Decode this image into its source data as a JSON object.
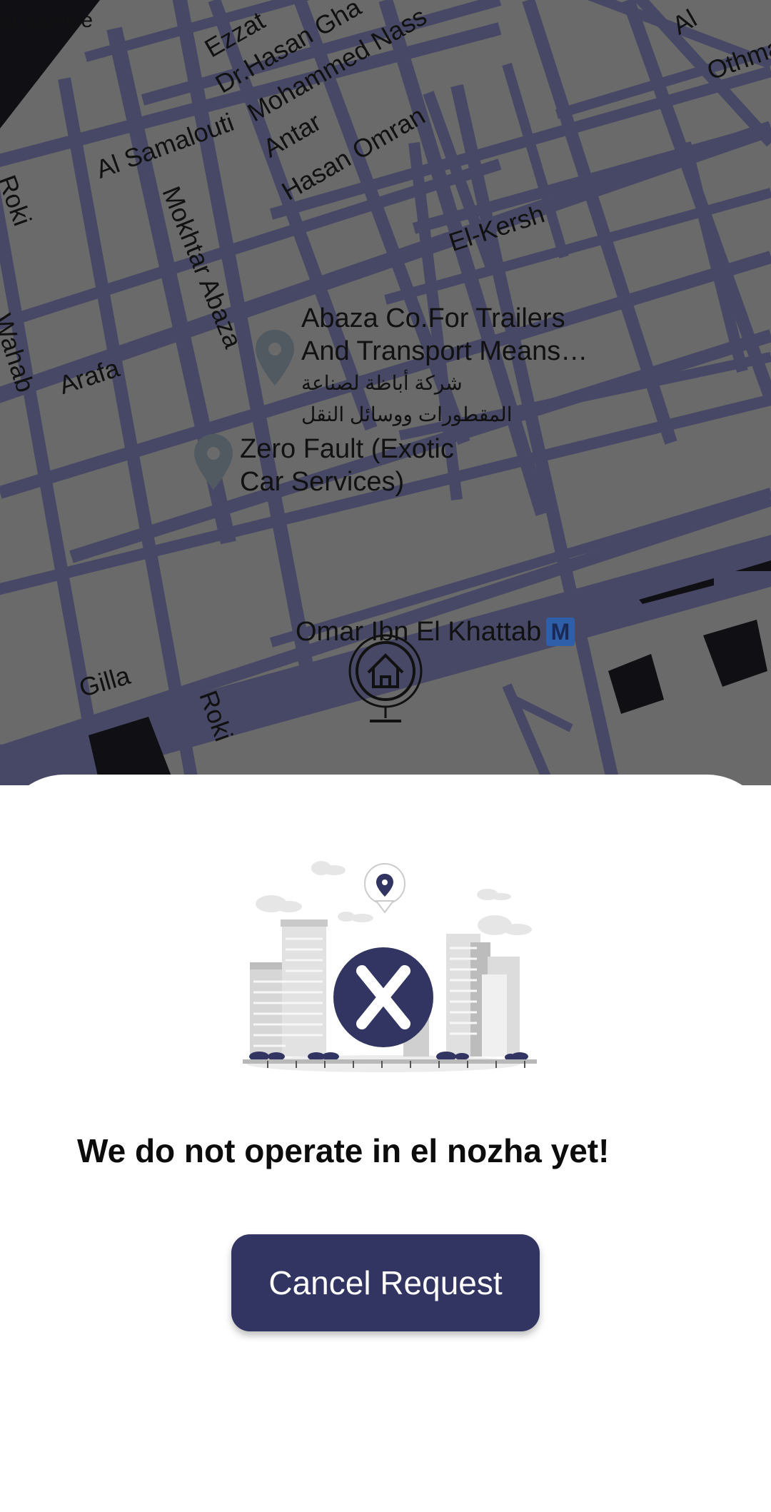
{
  "map": {
    "streets": [
      "Ezzat",
      "Dr.Hasan Gha",
      "Mohammed Nass",
      "Antar",
      "Hasan Omran",
      "Al Samalouti",
      "Mokhtar Abaza",
      "El-Kersh",
      "Arafa",
      "Roki",
      "Wahab",
      "Gilla",
      "Roki",
      "Al",
      "Othman"
    ],
    "corner_label": "ar service",
    "pois": [
      {
        "name_line1": "Abaza Co.For Trailers",
        "name_line2": "And Transport Means…",
        "arabic_line1": "شركة أباظة لصناعة",
        "arabic_line2": "المقطورات ووسائل النقل"
      },
      {
        "name_line1": "Zero Fault (Exotic",
        "name_line2": "Car Services)"
      }
    ],
    "station": {
      "name": "Omar Ibn El Khattab",
      "badge": "M"
    },
    "home_marker_icon": "home-location-pin-icon"
  },
  "sheet": {
    "illustration_icon": "city-buildings-x-icon",
    "message": "We do not operate in el nozha yet!",
    "cancel_label": "Cancel Request"
  },
  "colors": {
    "map_background": "#6a6a6a",
    "road": "#464865",
    "brand_navy": "#323561",
    "building_dark": "#101014"
  }
}
